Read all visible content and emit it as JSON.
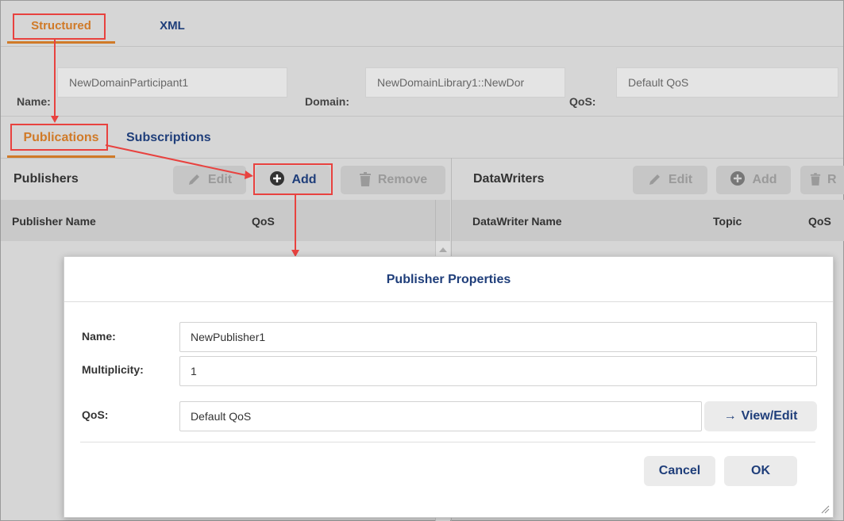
{
  "top_tabs": {
    "structured": "Structured",
    "xml": "XML"
  },
  "participant": {
    "name_label": "Name:",
    "name_value": "NewDomainParticipant1",
    "domain_label": "Domain:",
    "domain_value": "NewDomainLibrary1::NewDor",
    "qos_label": "QoS:",
    "qos_value": "Default QoS"
  },
  "sub_tabs": {
    "publications": "Publications",
    "subscriptions": "Subscriptions"
  },
  "publishers_panel": {
    "title": "Publishers",
    "edit": "Edit",
    "add": "Add",
    "remove": "Remove",
    "columns": [
      "Publisher Name",
      "QoS"
    ]
  },
  "datawriters_panel": {
    "title": "DataWriters",
    "edit": "Edit",
    "add": "Add",
    "remove_partial": "R",
    "columns": [
      "DataWriter Name",
      "Topic",
      "QoS"
    ]
  },
  "dialog": {
    "title": "Publisher Properties",
    "name_label": "Name:",
    "name_value": "NewPublisher1",
    "multiplicity_label": "Multiplicity:",
    "multiplicity_value": "1",
    "qos_label": "QoS:",
    "qos_value": "Default QoS",
    "view_edit": "View/Edit",
    "cancel": "Cancel",
    "ok": "OK"
  },
  "colors": {
    "accent_orange": "#d07a28",
    "navy": "#1f3e7a",
    "annotation_red": "#e8423f"
  }
}
